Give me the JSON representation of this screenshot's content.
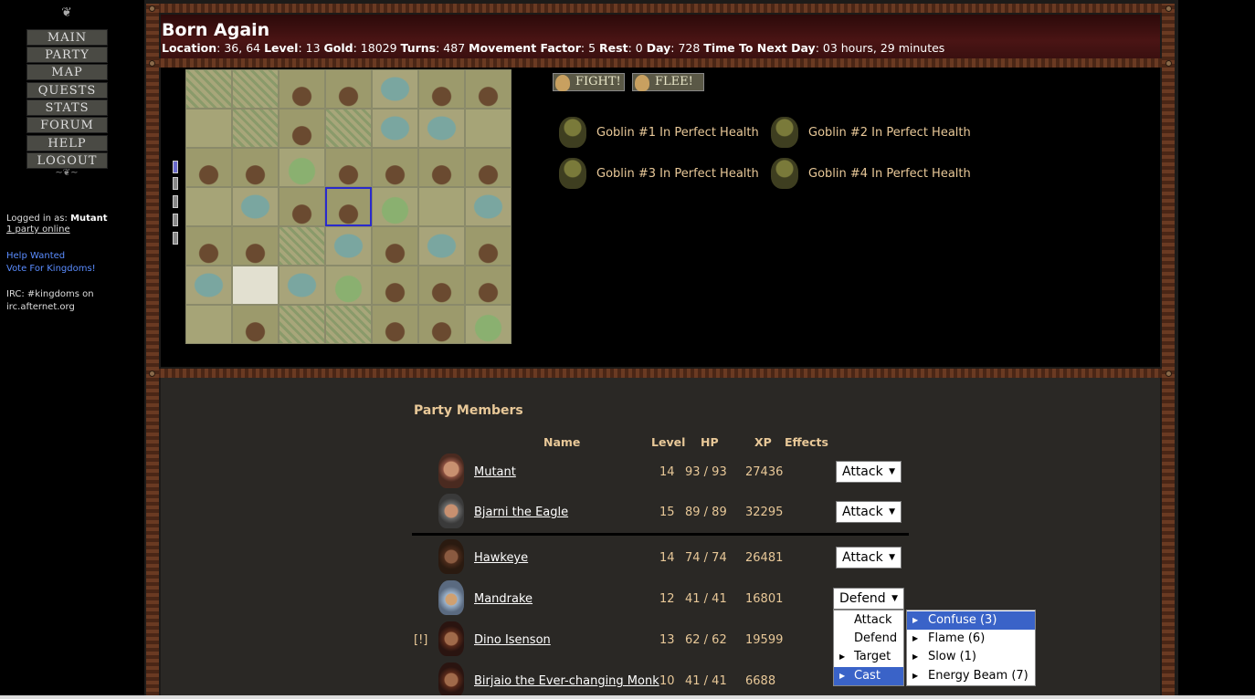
{
  "sidebar": {
    "nav": [
      "MAIN",
      "PARTY",
      "MAP",
      "QUESTS",
      "STATS",
      "FORUM",
      "HELP",
      "LOGOUT"
    ],
    "logged_in_label": "Logged in as:",
    "logged_in_user": "Mutant",
    "party_online": "1 party online",
    "help_wanted": "Help Wanted",
    "vote": "Vote For Kingdoms!",
    "irc_line1": "IRC: #kingdoms on",
    "irc_line2": "irc.afternet.org"
  },
  "header": {
    "title": "Born Again",
    "location_label": "Location",
    "location": ": 36, 64 ",
    "level_label": "Level",
    "level": ": 13 ",
    "gold_label": "Gold",
    "gold": ": 18029 ",
    "turns_label": "Turns",
    "turns": ": 487 ",
    "mf_label": "Movement Factor",
    "mf": ": 5 ",
    "rest_label": "Rest",
    "rest": ": 0 ",
    "day_label": "Day",
    "day": ": 728 ",
    "ttnd_label": "Time To Next Day",
    "ttnd": ": 03 hours, 29 minutes"
  },
  "combat": {
    "fight_label": "FIGHT!",
    "flee_label": "FLEE!",
    "monsters": [
      "Goblin #1 In Perfect Health",
      "Goblin #2 In Perfect Health",
      "Goblin #3 In Perfect Health",
      "Goblin #4 In Perfect Health"
    ]
  },
  "map": {
    "rows": [
      [
        "forest",
        "forest",
        "mtn",
        "mtn",
        "water",
        "mtn",
        "mtn"
      ],
      [
        "grass",
        "forest",
        "mtn",
        "forest",
        "water",
        "water",
        "grass"
      ],
      [
        "mtn",
        "mtn",
        "hill",
        "mtn",
        "mtn",
        "mtn",
        "mtn"
      ],
      [
        "grass",
        "water",
        "mtn",
        "mtn-sel",
        "hill",
        "grass",
        "water"
      ],
      [
        "mtn",
        "mtn",
        "forest",
        "water",
        "mtn",
        "water",
        "mtn"
      ],
      [
        "water",
        "town",
        "water",
        "hill",
        "mtn",
        "mtn",
        "mtn"
      ],
      [
        "grass",
        "mtn",
        "forest",
        "forest",
        "mtn",
        "mtn",
        "hill"
      ]
    ]
  },
  "party": {
    "title": "Party Members",
    "headers": {
      "name": "Name",
      "level": "Level",
      "hp": "HP",
      "xp": "XP",
      "effects": "Effects"
    },
    "members": [
      {
        "name": "Mutant",
        "level": "14",
        "hp": "93 / 93",
        "xp": "27436",
        "action": "Attack",
        "warn": ""
      },
      {
        "name": "Bjarni the Eagle",
        "level": "15",
        "hp": "89 / 89",
        "xp": "32295",
        "action": "Attack",
        "warn": ""
      },
      {
        "name": "Hawkeye",
        "level": "14",
        "hp": "74 / 74",
        "xp": "26481",
        "action": "Attack",
        "warn": ""
      },
      {
        "name": "Mandrake",
        "level": "12",
        "hp": "41 / 41",
        "xp": "16801",
        "action": "Defend",
        "warn": ""
      },
      {
        "name": "Dino Isenson",
        "level": "13",
        "hp": "62 / 62",
        "xp": "19599",
        "action": "",
        "warn": "[!]"
      },
      {
        "name": "Birjaio the Ever-changing Monk",
        "level": "10",
        "hp": "41 / 41",
        "xp": "6688",
        "action": "",
        "warn": ""
      }
    ]
  },
  "action_menu": {
    "items": [
      "Attack",
      "Defend",
      "Target",
      "Cast"
    ],
    "highlighted": "Cast"
  },
  "spell_menu": {
    "items": [
      "Confuse (3)",
      "Flame (6)",
      "Slow (1)",
      "Energy Beam (7)"
    ],
    "highlighted": "Confuse (3)"
  }
}
